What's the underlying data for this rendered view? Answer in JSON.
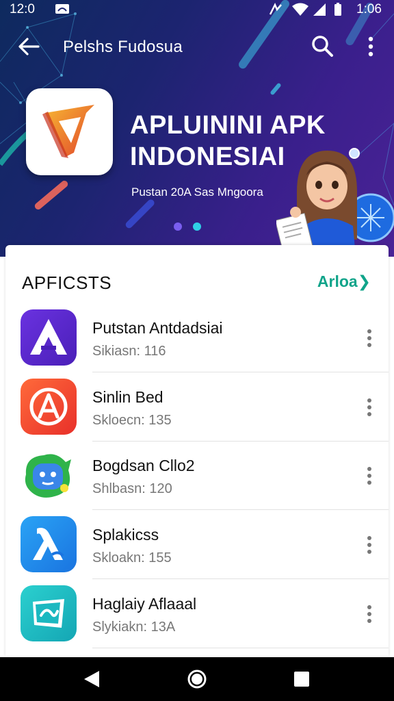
{
  "status_bar": {
    "time_left": "12:0",
    "time_right": "1:06"
  },
  "topbar": {
    "title": "Pelshs Fudosua"
  },
  "hero": {
    "title": "APLUININI APK INDONESIAI",
    "subtitle": "Pustan 20A Sas Mngoora"
  },
  "section": {
    "title": "APFICSTS",
    "link": "Arloa"
  },
  "apps": [
    {
      "name": "Putstan Antdadsiai",
      "meta": "Sikiasn: 116",
      "icon": "triangle-a-icon",
      "color": "#5a2bd8"
    },
    {
      "name": "Sinlin Bed",
      "meta": "Skloecn: 135",
      "icon": "circle-a-icon",
      "color": "#f0472d"
    },
    {
      "name": "Bogdsan Cllo2",
      "meta": "Shlbasn: 120",
      "icon": "robot-icon",
      "color": "#3a86e8"
    },
    {
      "name": "Splakicss",
      "meta": "Skloakn: 155",
      "icon": "lambda-icon",
      "color": "#1e88e5"
    },
    {
      "name": "Haglaiy Aflaaal",
      "meta": "Slykiakn: 13A",
      "icon": "map-icon",
      "color": "#1ec0c8"
    }
  ],
  "colors": {
    "accent": "#10a48a",
    "hero_bg": "#1c2470"
  }
}
